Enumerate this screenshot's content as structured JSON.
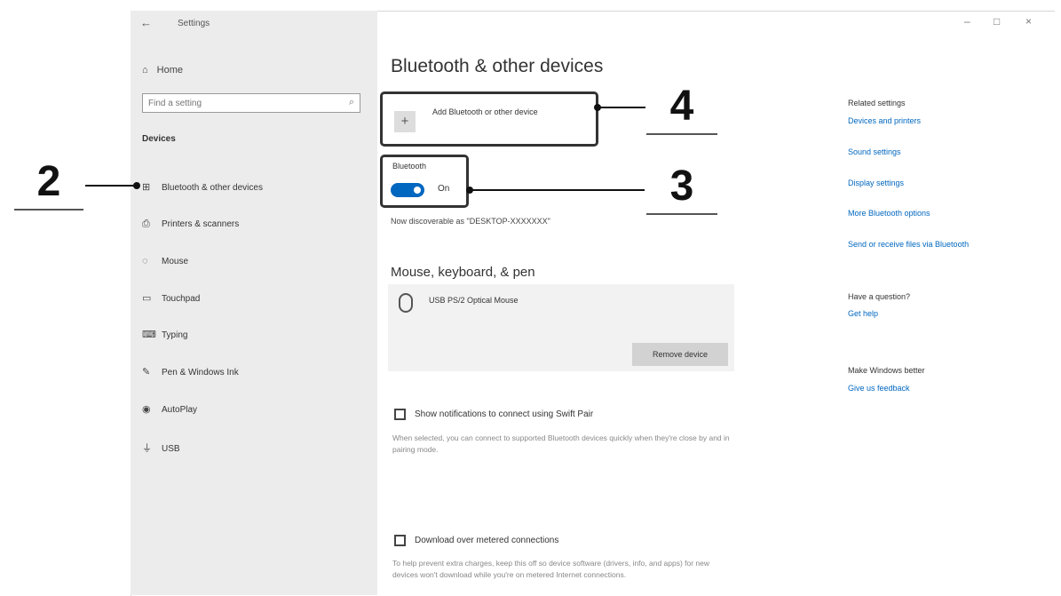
{
  "window": {
    "title": "Settings",
    "back_icon": "back-arrow-icon",
    "controls": [
      "–",
      "□",
      "×"
    ]
  },
  "sidebar": {
    "home_label": "Home",
    "search_placeholder": "Find a setting",
    "section_title": "Devices",
    "items": [
      {
        "icon": "bluetooth-devices-icon",
        "glyph": "⊞",
        "label": "Bluetooth & other devices"
      },
      {
        "icon": "printer-icon",
        "glyph": "⎙",
        "label": "Printers & scanners"
      },
      {
        "icon": "mouse-icon",
        "glyph": "◌",
        "label": "Mouse"
      },
      {
        "icon": "touchpad-icon",
        "glyph": "▭",
        "label": "Touchpad"
      },
      {
        "icon": "keyboard-icon",
        "glyph": "⌨",
        "label": "Typing"
      },
      {
        "icon": "pen-icon",
        "glyph": "✎",
        "label": "Pen & Windows Ink"
      },
      {
        "icon": "autoplay-icon",
        "glyph": "◉",
        "label": "AutoPlay"
      },
      {
        "icon": "usb-icon",
        "glyph": "⏚",
        "label": "USB"
      }
    ]
  },
  "main": {
    "title": "Bluetooth & other devices",
    "add_device_label": "Add Bluetooth or other device",
    "bluetooth_label": "Bluetooth",
    "bluetooth_state": "On",
    "discoverable_text": "Now discoverable as \"DESKTOP-XXXXXXX\"",
    "mouse_section_title": "Mouse, keyboard, & pen",
    "mouse_device_name": "USB PS/2 Optical Mouse",
    "remove_device_label": "Remove device",
    "swift_pair": {
      "label": "Show notifications to connect using Swift Pair",
      "desc": "When selected, you can connect to supported Bluetooth devices quickly when they're close by and in pairing mode."
    },
    "metered": {
      "label": "Download over metered connections",
      "desc": "To help prevent extra charges, keep this off so device software (drivers, info, and apps) for new devices won't download while you're on metered Internet connections."
    }
  },
  "right_rail": {
    "related_title": "Related settings",
    "related_links": [
      "Devices and printers",
      "Sound settings",
      "Display settings",
      "More Bluetooth options",
      "Send or receive files via Bluetooth"
    ],
    "question_title": "Have a question?",
    "question_link": "Get help",
    "better_title": "Make Windows better",
    "better_link": "Give us feedback"
  },
  "annotations": {
    "callout_2": "2",
    "callout_3": "3",
    "callout_4": "4"
  },
  "colors": {
    "accent": "#0067c0",
    "sidebar_bg": "#ececec"
  }
}
